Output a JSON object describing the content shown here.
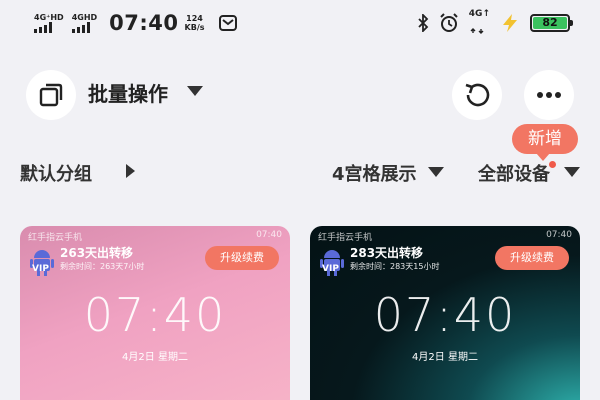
{
  "status_bar": {
    "signal_1_label": "4G⁺HD",
    "signal_2_label": "4GHD",
    "time": "07:40",
    "speed_value": "124",
    "speed_unit": "KB/s",
    "net_label": "4G↑",
    "battery_level": "82",
    "battery_color": "#3bc25f"
  },
  "toolbar": {
    "batch_label": "批量操作",
    "multi_window_icon": "multi-window-icon",
    "refresh_icon": "refresh-icon",
    "more_icon": "more-icon"
  },
  "filters": {
    "group_label": "默认分组",
    "grid_label": "4宫格展示",
    "devices_label": "全部设备",
    "new_badge": "新增"
  },
  "cards": [
    {
      "title": "红手指云手机",
      "status_time": "07:40",
      "vip_label": "VIP",
      "days_label": "263天出转移",
      "remaining": "剩余时间：263天7小时",
      "renew_label": "升级续费",
      "clock": "07:40",
      "date": "4月2日  星期二"
    },
    {
      "title": "红手指云手机",
      "status_time": "07:40",
      "vip_label": "VIP",
      "days_label": "283天出转移",
      "remaining": "剩余时间：283天15小时",
      "renew_label": "升级续费",
      "clock": "07:40",
      "date": "4月2日  星期二"
    }
  ],
  "colors": {
    "accent": "#f27663",
    "background": "#f1f1f5"
  }
}
